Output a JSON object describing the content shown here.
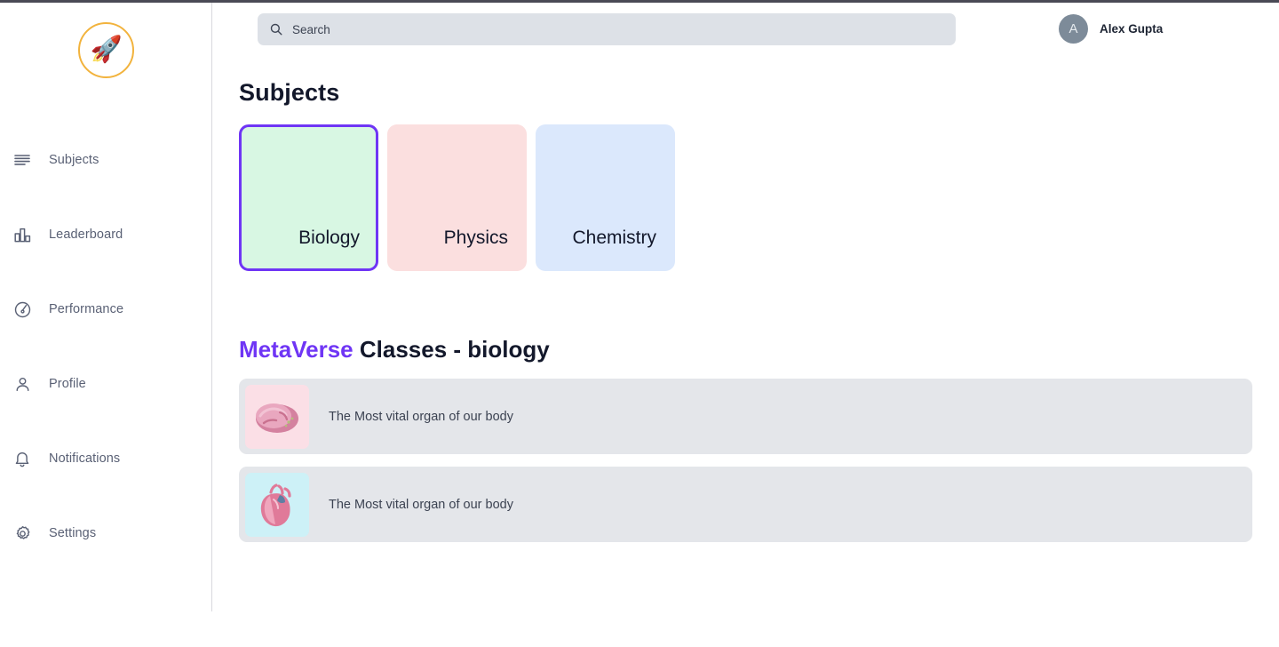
{
  "brand": {
    "logo_icon": "rocket-icon",
    "logo_glyph": "🚀",
    "ring_color": "#f2b33d"
  },
  "sidebar": {
    "items": [
      {
        "label": "Subjects",
        "icon": "list-lines-icon"
      },
      {
        "label": "Leaderboard",
        "icon": "bar-chart-icon"
      },
      {
        "label": "Performance",
        "icon": "speedometer-icon"
      },
      {
        "label": "Profile",
        "icon": "user-icon"
      },
      {
        "label": "Notifications",
        "icon": "bell-icon"
      },
      {
        "label": "Settings",
        "icon": "gear-icon"
      }
    ]
  },
  "header": {
    "search": {
      "icon": "search-icon",
      "placeholder": "Search",
      "value": ""
    },
    "user": {
      "avatar_initial": "A",
      "name": "Alex Gupta"
    }
  },
  "main": {
    "subjects_heading": "Subjects",
    "subjects": [
      {
        "label": "Biology",
        "bg": "#d8f7e3",
        "selected": true,
        "border": "#6f35f5"
      },
      {
        "label": "Physics",
        "bg": "#fbdfdf",
        "selected": false,
        "border": "transparent"
      },
      {
        "label": "Chemistry",
        "bg": "#dbe8fc",
        "selected": false,
        "border": "transparent"
      }
    ],
    "classes_heading": {
      "brand": "MetaVerse",
      "rest": " Classes - biology"
    },
    "classes": [
      {
        "title": "The Most vital organ of our body",
        "thumb_icon": "brain-icon",
        "thumb_bg": "#fbdfe6",
        "thumb_color": "#d98aa8"
      },
      {
        "title": "The Most vital organ of our body",
        "thumb_icon": "heart-organ-icon",
        "thumb_bg": "#cdf1f7",
        "thumb_color": "#e8849f"
      }
    ]
  },
  "colors": {
    "accent": "#6f35f5",
    "row_bg": "#e4e6ea",
    "search_bg": "#dde1e7",
    "text": "#3c4352"
  }
}
